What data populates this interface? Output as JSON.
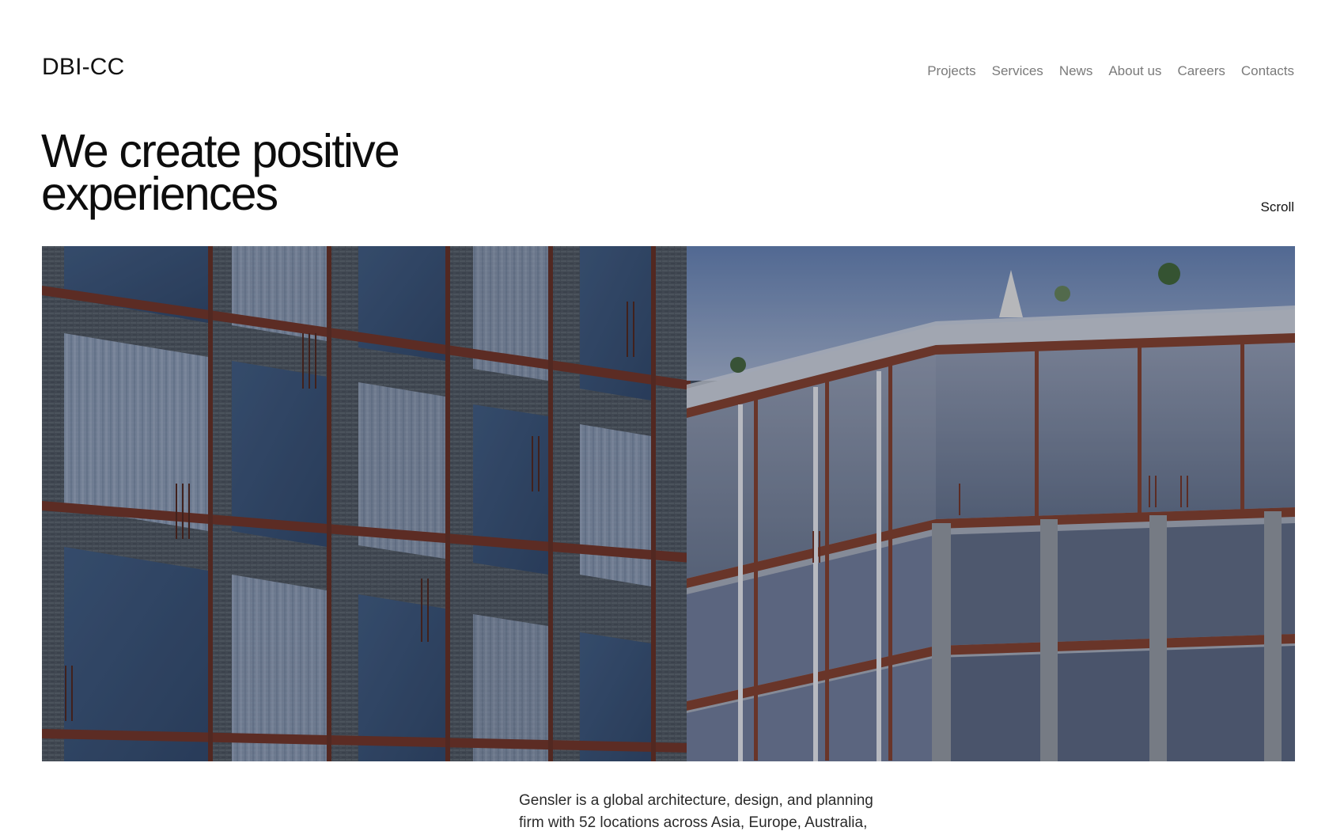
{
  "header": {
    "logo": "DBI-CC",
    "nav": [
      "Projects",
      "Services",
      "News",
      "About us",
      "Careers",
      "Contacts"
    ]
  },
  "hero": {
    "headline_line1": "We create positive",
    "headline_line2": "experiences",
    "scroll_label": "Scroll",
    "image_subject": "building-facade-photo"
  },
  "intro": {
    "text": "Gensler is a global architecture, design, and planning firm with 52 locations across Asia, Europe, Australia,"
  },
  "colors": {
    "nav_text": "#7a7a7a",
    "text": "#111111",
    "glass": "#3f5a7c",
    "frame": "#6b2f22",
    "brick": "#4a525a",
    "sky": "#7e93b3"
  }
}
